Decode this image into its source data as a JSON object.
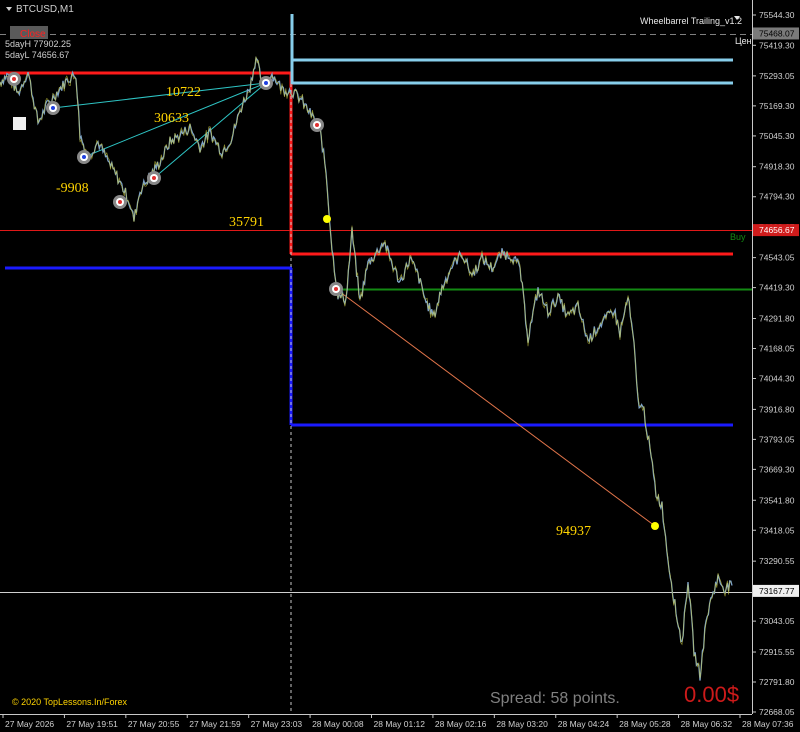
{
  "window": {
    "symbol": "BTCUSD,M1",
    "indicator_name": "Wheelbarrel Trailing_v1.2",
    "top_right_partial": "Цен",
    "top_left_badge": "Close",
    "day_high": "5dayH 77902.25",
    "day_low": "5dayL 74656.67",
    "watermark": "© 2020 TopLessons.In/Forex",
    "spread_text": "Spread: 58 points.",
    "profit_text": "0.00$",
    "buy_tag": "Buy"
  },
  "colors": {
    "background": "#000000",
    "axis_text": "#c8c8c8",
    "red_level": "#ff1a1a",
    "blue_level": "#1a1aff",
    "green_level": "#138a13",
    "lightblue_level": "#87ceeb",
    "cyan_line": "#2ec4c4",
    "yellow_text": "#ffd400",
    "price_line": "#7fa4c8",
    "price_wick": "#c8c840",
    "orange_line": "#e0744a"
  },
  "chart_data": {
    "type": "line",
    "price_axis": {
      "ticks": [
        "75544.30",
        "75419.30",
        "75293.05",
        "75169.30",
        "75045.30",
        "74918.30",
        "74794.30",
        "74668.67",
        "74543.05",
        "74419.30",
        "74291.80",
        "74168.05",
        "74044.30",
        "73916.80",
        "73793.05",
        "73669.30",
        "73541.80",
        "73418.05",
        "73290.55",
        "73166.80",
        "73043.05",
        "72915.55",
        "72791.80",
        "72668.05"
      ],
      "ylim": [
        72668.05,
        75544.3
      ],
      "highlight_labels": [
        {
          "text": "75468.07",
          "price": 75468.07,
          "role": "dashed-level"
        },
        {
          "text": "74656.67",
          "price": 74656.67,
          "role": "red-level"
        },
        {
          "text": "73167.77",
          "price": 73167.77,
          "role": "current-price"
        }
      ]
    },
    "time_axis": {
      "ticks": [
        "27 May 2026",
        "27 May 19:51",
        "27 May 20:55",
        "27 May 21:59",
        "27 May 23:03",
        "28 May 00:08",
        "28 May 01:12",
        "28 May 02:16",
        "28 May 03:20",
        "28 May 04:24",
        "28 May 05:28",
        "28 May 06:32",
        "28 May 07:36"
      ]
    },
    "levels": [
      {
        "name": "5dayL",
        "price": 74656.67,
        "color": "#ff1a1a"
      },
      {
        "name": "current",
        "price": 73167.77,
        "color": "#d0d0d0"
      },
      {
        "name": "dashed-top",
        "price": 75468.07,
        "color": "#808080"
      }
    ],
    "annotations": [
      "10722",
      "30633",
      "-9908",
      "35791",
      "94937"
    ],
    "price_path": [
      [
        0,
        75268
      ],
      [
        8,
        75300
      ],
      [
        18,
        75220
      ],
      [
        28,
        75310
      ],
      [
        38,
        75100
      ],
      [
        48,
        75180
      ],
      [
        58,
        75230
      ],
      [
        68,
        75280
      ],
      [
        76,
        75300
      ],
      [
        80,
        75050
      ],
      [
        88,
        74960
      ],
      [
        98,
        75020
      ],
      [
        108,
        74940
      ],
      [
        118,
        74870
      ],
      [
        128,
        74790
      ],
      [
        134,
        74700
      ],
      [
        140,
        74820
      ],
      [
        150,
        74880
      ],
      [
        160,
        74940
      ],
      [
        170,
        75020
      ],
      [
        180,
        75050
      ],
      [
        190,
        75080
      ],
      [
        200,
        75000
      ],
      [
        210,
        75060
      ],
      [
        222,
        74980
      ],
      [
        232,
        75040
      ],
      [
        240,
        75150
      ],
      [
        250,
        75250
      ],
      [
        256,
        75370
      ],
      [
        262,
        75260
      ],
      [
        272,
        75300
      ],
      [
        282,
        75240
      ],
      [
        292,
        75230
      ],
      [
        300,
        75200
      ],
      [
        310,
        75140
      ],
      [
        320,
        75070
      ],
      [
        326,
        74900
      ],
      [
        332,
        74580
      ],
      [
        338,
        74390
      ],
      [
        346,
        74370
      ],
      [
        352,
        74650
      ],
      [
        360,
        74360
      ],
      [
        368,
        74520
      ],
      [
        376,
        74560
      ],
      [
        384,
        74610
      ],
      [
        392,
        74520
      ],
      [
        400,
        74440
      ],
      [
        410,
        74540
      ],
      [
        418,
        74470
      ],
      [
        426,
        74360
      ],
      [
        434,
        74300
      ],
      [
        442,
        74420
      ],
      [
        452,
        74510
      ],
      [
        462,
        74560
      ],
      [
        472,
        74470
      ],
      [
        482,
        74540
      ],
      [
        492,
        74500
      ],
      [
        502,
        74560
      ],
      [
        512,
        74550
      ],
      [
        520,
        74500
      ],
      [
        528,
        74210
      ],
      [
        538,
        74410
      ],
      [
        548,
        74320
      ],
      [
        558,
        74380
      ],
      [
        568,
        74300
      ],
      [
        578,
        74340
      ],
      [
        588,
        74200
      ],
      [
        598,
        74260
      ],
      [
        606,
        74290
      ],
      [
        614,
        74330
      ],
      [
        620,
        74230
      ],
      [
        628,
        74380
      ],
      [
        634,
        74180
      ],
      [
        638,
        73950
      ],
      [
        644,
        73910
      ],
      [
        650,
        73750
      ],
      [
        656,
        73570
      ],
      [
        662,
        73520
      ],
      [
        668,
        73300
      ],
      [
        676,
        73080
      ],
      [
        682,
        72950
      ],
      [
        688,
        73220
      ],
      [
        694,
        72920
      ],
      [
        700,
        72820
      ],
      [
        706,
        73040
      ],
      [
        712,
        73150
      ],
      [
        718,
        73220
      ],
      [
        724,
        73180
      ],
      [
        732,
        73190
      ]
    ]
  }
}
